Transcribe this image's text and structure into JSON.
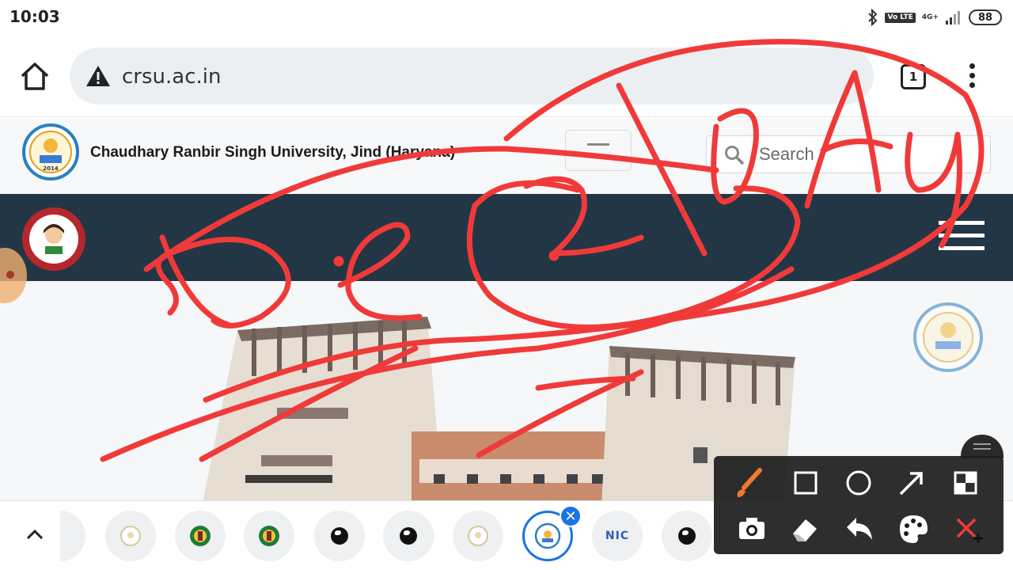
{
  "status_bar": {
    "time": "10:03",
    "volte": "Vo LTE",
    "network": "4G+",
    "battery": "88"
  },
  "browser": {
    "url": "crsu.ac.in",
    "tab_count": "1",
    "icons": {
      "home": "home-icon",
      "security": "warning-triangle-icon",
      "menu": "kebab-menu-icon"
    }
  },
  "site": {
    "university_name": "Chaudhary Ranbir Singh University, Jind (Haryana)",
    "logo_year": "2014",
    "search_placeholder": "Search",
    "colors": {
      "nav_band": "#233645",
      "logo_ring": "#2a7fc1",
      "bbbp_ring": "#b5272c"
    }
  },
  "tab_switcher": {
    "tabs": [
      {
        "icon": "university-logo-icon",
        "active": false
      },
      {
        "icon": "emblem-icon",
        "active": false
      },
      {
        "icon": "emblem-icon",
        "active": false
      },
      {
        "icon": "globe-icon",
        "active": false
      },
      {
        "icon": "globe-icon",
        "active": false
      },
      {
        "icon": "university-logo-icon",
        "active": false
      },
      {
        "icon": "university-logo-icon",
        "active": true
      },
      {
        "icon": "nic-icon",
        "label": "NIC",
        "active": false
      },
      {
        "icon": "globe-icon",
        "active": false
      }
    ],
    "close_symbol": "✕"
  },
  "drawing_toolbar": {
    "tools": [
      "brush-icon",
      "rectangle-icon",
      "circle-icon",
      "arrow-icon",
      "blur-icon",
      "camera-icon",
      "eraser-icon",
      "undo-icon",
      "palette-icon",
      "close-icon"
    ],
    "ink_color": "#f03a3a"
  }
}
